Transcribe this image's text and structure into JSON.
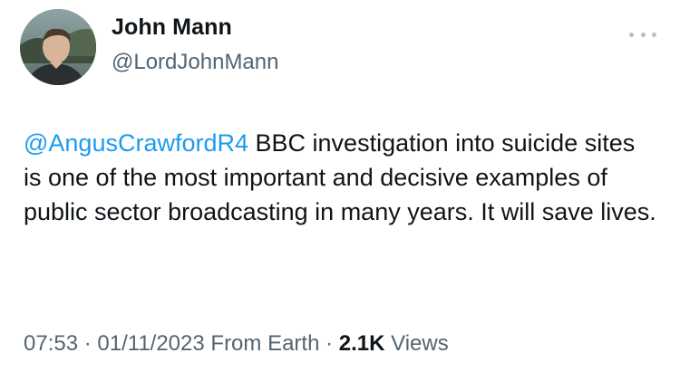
{
  "author": {
    "name": "John Mann",
    "handle": "@LordJohnMann"
  },
  "tweet": {
    "mention": "@AngusCrawfordR4",
    "text": " BBC investigation into suicide sites is one of the most important and decisive examples of public sector broadcasting in many years. It will save lives."
  },
  "meta": {
    "time": "07:53",
    "separator": " · ",
    "date": "01/11/2023",
    "source": " From Earth",
    "separator2": " · ",
    "views_count": "2.1K",
    "views_label": " Views"
  },
  "icons": {
    "more": "more-horizontal-icon"
  }
}
